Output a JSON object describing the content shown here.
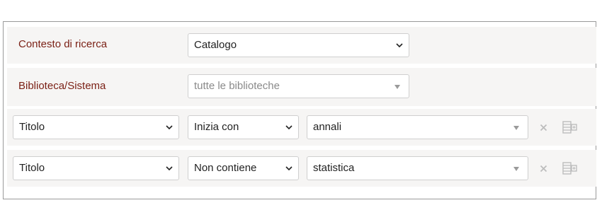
{
  "search_context": {
    "label": "Contesto di ricerca",
    "value": "Catalogo"
  },
  "library": {
    "label": "Biblioteca/Sistema",
    "placeholder": "tutte le biblioteche"
  },
  "criteria": [
    {
      "field": "Titolo",
      "operator": "Inizia con",
      "value": "annali"
    },
    {
      "field": "Titolo",
      "operator": "Non contiene",
      "value": "statistica"
    }
  ],
  "icons": {
    "remove": "close-icon",
    "add": "add-row-icon"
  },
  "colors": {
    "label": "#7a1f14",
    "border": "#cfcfcf",
    "row_background": "#f6f5f4"
  }
}
